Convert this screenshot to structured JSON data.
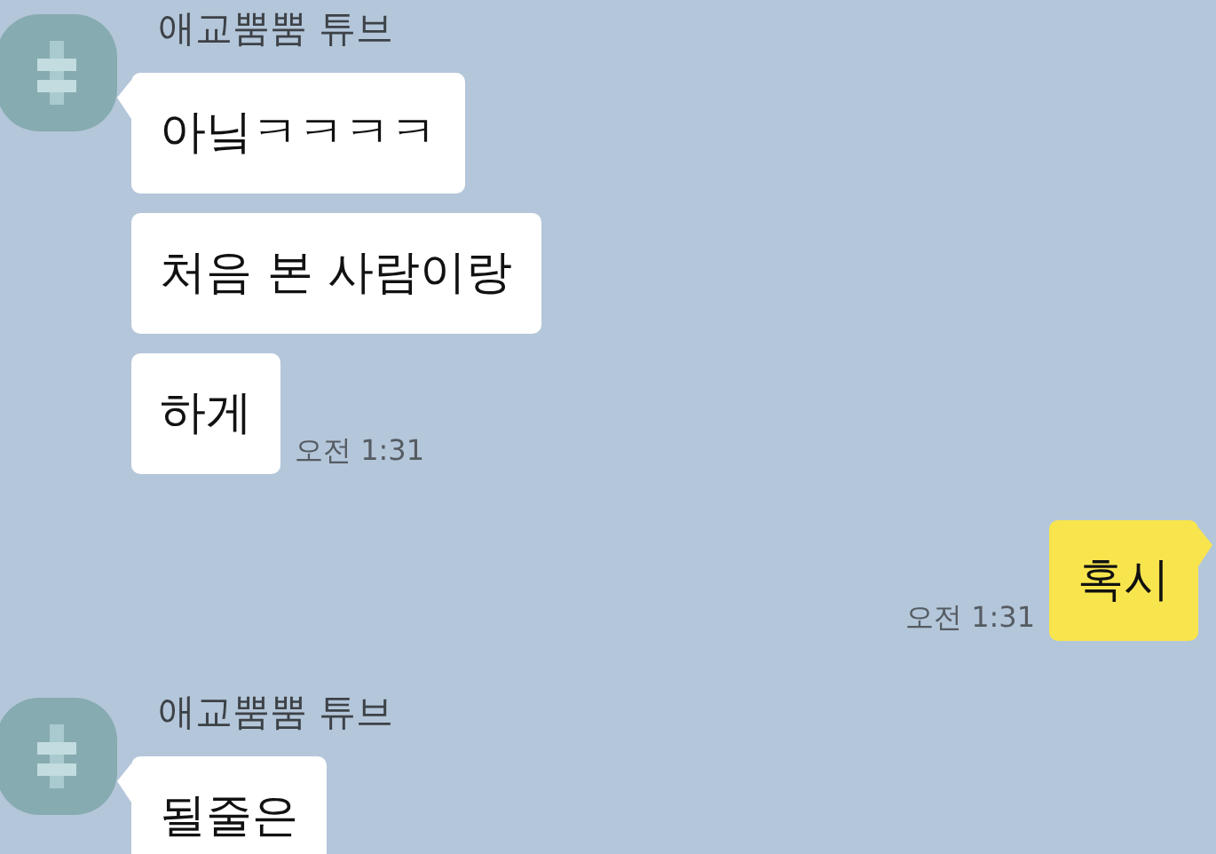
{
  "messages": [
    {
      "kind": "received",
      "sender": "애교뿜뿜 튜브",
      "bubbles": [
        "아닠ㅋㅋㅋㅋ",
        "처음 본 사람이랑",
        "하게"
      ],
      "time": "오전 1:31"
    },
    {
      "kind": "sent",
      "bubbles": [
        "혹시"
      ],
      "time": "오전 1:31"
    },
    {
      "kind": "received",
      "sender": "애교뿜뿜 튜브",
      "bubbles": [
        "될줄은"
      ]
    }
  ]
}
